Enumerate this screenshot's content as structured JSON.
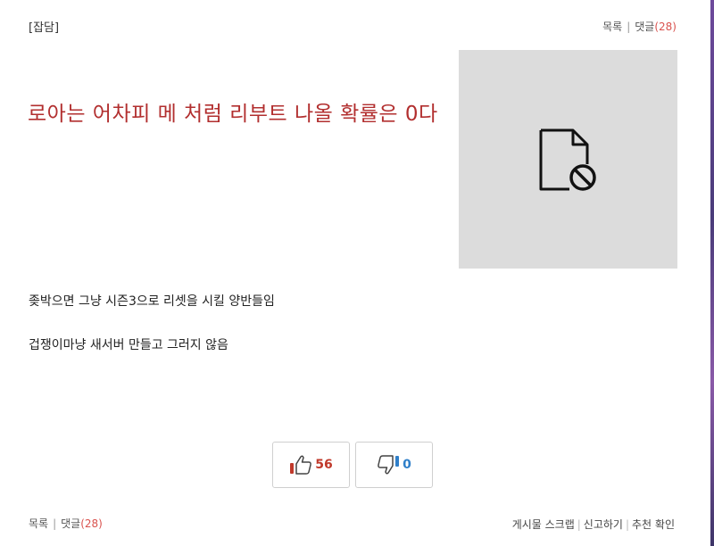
{
  "post": {
    "category": "[잡담]",
    "title": "로아는 어차피 메 처럼 리부트 나올 확률은 0다",
    "body_lines": [
      "좆박으면 그냥 시즌3으로 리셋을 시킬 양반들임",
      "겁쟁이마냥 새서버 만들고 그러지 않음"
    ]
  },
  "nav": {
    "list_label": "목록",
    "separator": "|",
    "comments_label": "댓글",
    "comment_count": "(28)"
  },
  "thumbnail": {
    "icon": "file-blocked-icon",
    "background": "#dcdcdc"
  },
  "votes": {
    "up_count": "56",
    "down_count": "0",
    "up_color": "#c0392b",
    "down_color": "#2f7fc9"
  },
  "actions": {
    "scrap_label": "게시물 스크랩",
    "report_label": "신고하기",
    "recommend_check_label": "추천 확인",
    "separator": "|"
  },
  "colors": {
    "title": "#b22f2f",
    "accent_count": "#d9534f"
  }
}
